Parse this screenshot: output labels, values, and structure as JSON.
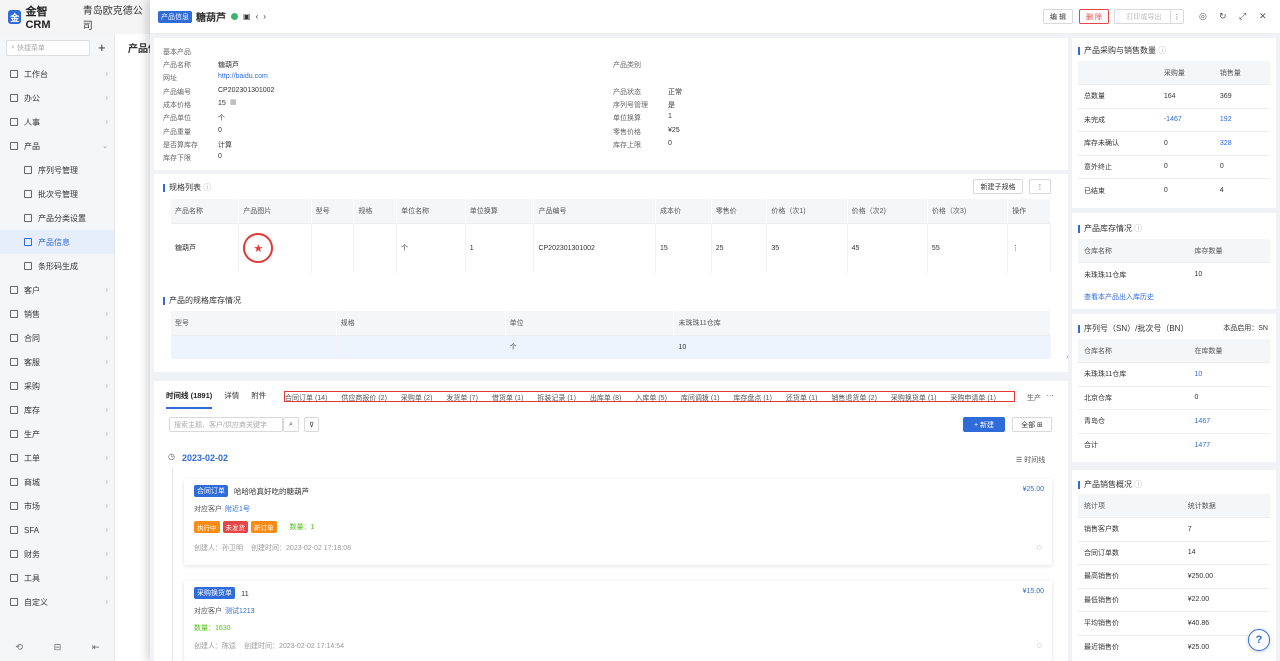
{
  "brand": {
    "logo": "金智CRM",
    "company": "青岛欧克德公司"
  },
  "sidebar": {
    "search_placeholder": "快捷菜单",
    "items": [
      {
        "label": "工作台",
        "icon": "grid-icon",
        "sub": false
      },
      {
        "label": "办公",
        "icon": "briefcase-icon",
        "sub": false
      },
      {
        "label": "人事",
        "icon": "user-icon",
        "sub": false
      },
      {
        "label": "产品",
        "icon": "box-icon",
        "sub": false,
        "active_parent": true
      },
      {
        "label": "序列号管理",
        "icon": "folder-icon",
        "sub": true
      },
      {
        "label": "批次号管理",
        "icon": "folder-icon",
        "sub": true
      },
      {
        "label": "产品分类设置",
        "icon": "gear-icon",
        "sub": true
      },
      {
        "label": "产品信息",
        "icon": "doc-icon",
        "sub": true,
        "active": true
      },
      {
        "label": "条形码生成",
        "icon": "barcode-icon",
        "sub": true
      },
      {
        "label": "客户",
        "icon": "user-icon",
        "sub": false
      },
      {
        "label": "销售",
        "icon": "cart-icon",
        "sub": false
      },
      {
        "label": "合同",
        "icon": "contract-icon",
        "sub": false
      },
      {
        "label": "客服",
        "icon": "headset-icon",
        "sub": false
      },
      {
        "label": "采购",
        "icon": "purchase-icon",
        "sub": false
      },
      {
        "label": "库存",
        "icon": "warehouse-icon",
        "sub": false
      },
      {
        "label": "生产",
        "icon": "factory-icon",
        "sub": false
      },
      {
        "label": "工单",
        "icon": "ticket-icon",
        "sub": false
      },
      {
        "label": "商城",
        "icon": "shop-icon",
        "sub": false
      },
      {
        "label": "市场",
        "icon": "market-icon",
        "sub": false
      },
      {
        "label": "SFA",
        "icon": "sfa-icon",
        "sub": false
      },
      {
        "label": "财务",
        "icon": "finance-icon",
        "sub": false
      },
      {
        "label": "工具",
        "icon": "tool-icon",
        "sub": false
      },
      {
        "label": "自定义",
        "icon": "custom-icon",
        "sub": false
      }
    ]
  },
  "bg_title": "产品信",
  "header": {
    "tag": "产品信息",
    "name": "糖葫芦",
    "edit": "编 辑",
    "delete": "删 除",
    "print": "打印或导出",
    "more": "⋮"
  },
  "basic": {
    "title": "基本产品",
    "left": [
      {
        "k": "产品名称",
        "v": "糖葫芦"
      },
      {
        "k": "网址",
        "v": "http://baidu.com",
        "link": true
      },
      {
        "k": "产品编号",
        "v": "CP202301301002"
      },
      {
        "k": "成本价格",
        "v": "15"
      },
      {
        "k": "产品单位",
        "v": "个"
      },
      {
        "k": "产品重量",
        "v": "0"
      },
      {
        "k": "是否算库存",
        "v": "计算"
      },
      {
        "k": "库存下限",
        "v": "0"
      }
    ],
    "right": [
      {
        "k": "产品类别",
        "v": ""
      },
      {
        "k": "产品状态",
        "v": "正常"
      },
      {
        "k": "序列号管理",
        "v": "是"
      },
      {
        "k": "单位换算",
        "v": "1"
      },
      {
        "k": "零售价格",
        "v": "¥25"
      },
      {
        "k": "库存上限",
        "v": "0"
      }
    ]
  },
  "spec": {
    "title": "规格列表",
    "new_btn": "新建子规格",
    "headers": [
      "产品名称",
      "产品图片",
      "型号",
      "规格",
      "单位名称",
      "单位换算",
      "产品编号",
      "成本价",
      "零售价",
      "价格（次1)",
      "价格（次2)",
      "价格（次3)",
      "操作"
    ],
    "row": [
      "糖葫芦",
      "",
      "",
      "",
      "个",
      "1",
      "CP202301301002",
      "15",
      "25",
      "35",
      "45",
      "55",
      "⋮"
    ]
  },
  "stock_spec": {
    "title": "产品的规格库存情况",
    "headers": [
      "型号",
      "规格",
      "单位",
      "未珠珠11仓库"
    ],
    "row": [
      "",
      "",
      "个",
      "10"
    ]
  },
  "timeline": {
    "tabs": [
      "时间线 (1891)",
      "详情",
      "附件"
    ],
    "subtabs": [
      "合同订单 (14)",
      "供应商报价 (2)",
      "采购单 (2)",
      "发货单 (7)",
      "借货单 (1)",
      "拆装记录 (1)",
      "出库单 (8)",
      "入库单 (5)",
      "库间调拨 (1)",
      "库存盘点 (1)",
      "还货单 (1)",
      "销售退货单 (2)",
      "采购换货单 (1)",
      "采购申请单 (1)"
    ],
    "more_tab": "生产",
    "search_placeholder": "搜索主题、客户/供应商关键字",
    "new_btn": "+ 新建",
    "all_btn": "全部",
    "date": "2023-02-02",
    "view": "时间线",
    "entries": [
      {
        "tag": "合同订单",
        "title": "哈哈哈真好吃的糖葫芦",
        "amount": "¥25.00",
        "cust_label": "对应客户",
        "cust": "附近1号",
        "badges": [
          "执行中",
          "未发货",
          "新订单"
        ],
        "qty": "数量：1",
        "creator": "创建人：孙卫明",
        "time": "创建时间：2023-02-02 17:18:08"
      },
      {
        "tag": "采购换货单",
        "title": "11",
        "amount": "¥15.00",
        "cust_label": "对应客户",
        "cust": "测试1213",
        "badges": [],
        "qty": "数量：1630",
        "creator": "创建人：陈逵",
        "time": "创建时间：2023-02-02 17:14:54"
      }
    ]
  },
  "purchase_sales": {
    "title": "产品采购与销售数量",
    "headers": [
      "",
      "采购量",
      "销售量"
    ],
    "rows": [
      [
        "总数量",
        "164",
        "369"
      ],
      [
        "未完成",
        "-1467",
        "192"
      ],
      [
        "库存未确认",
        "0",
        "328"
      ],
      [
        "意外终止",
        "0",
        "0"
      ],
      [
        "已结束",
        "0",
        "4"
      ]
    ]
  },
  "inventory": {
    "title": "产品库存情况",
    "headers": [
      "仓库名称",
      "库存数量"
    ],
    "rows": [
      [
        "未珠珠11仓库",
        "10"
      ]
    ],
    "link": "查看本产品出入库历史"
  },
  "sn": {
    "title": "序列号（SN）/批次号（BN）",
    "enabled": "本品启用：SN",
    "headers": [
      "仓库名称",
      "在库数量"
    ],
    "rows": [
      [
        "未珠珠11仓库",
        "10"
      ],
      [
        "北京仓库",
        "0"
      ],
      [
        "青岛仓",
        "1467"
      ],
      [
        "合计",
        "1477"
      ]
    ]
  },
  "sales": {
    "title": "产品销售概况",
    "headers": [
      "统计项",
      "统计数据"
    ],
    "rows": [
      [
        "销售客户数",
        "7"
      ],
      [
        "合同订单数",
        "14"
      ],
      [
        "最高销售价",
        "¥250.00"
      ],
      [
        "最低销售价",
        "¥22.00"
      ],
      [
        "平均销售价",
        "¥40.86"
      ],
      [
        "最近销售价",
        "¥25.00"
      ]
    ]
  },
  "colors": {
    "accent": "#2f6bd9",
    "danger": "#e54545"
  }
}
